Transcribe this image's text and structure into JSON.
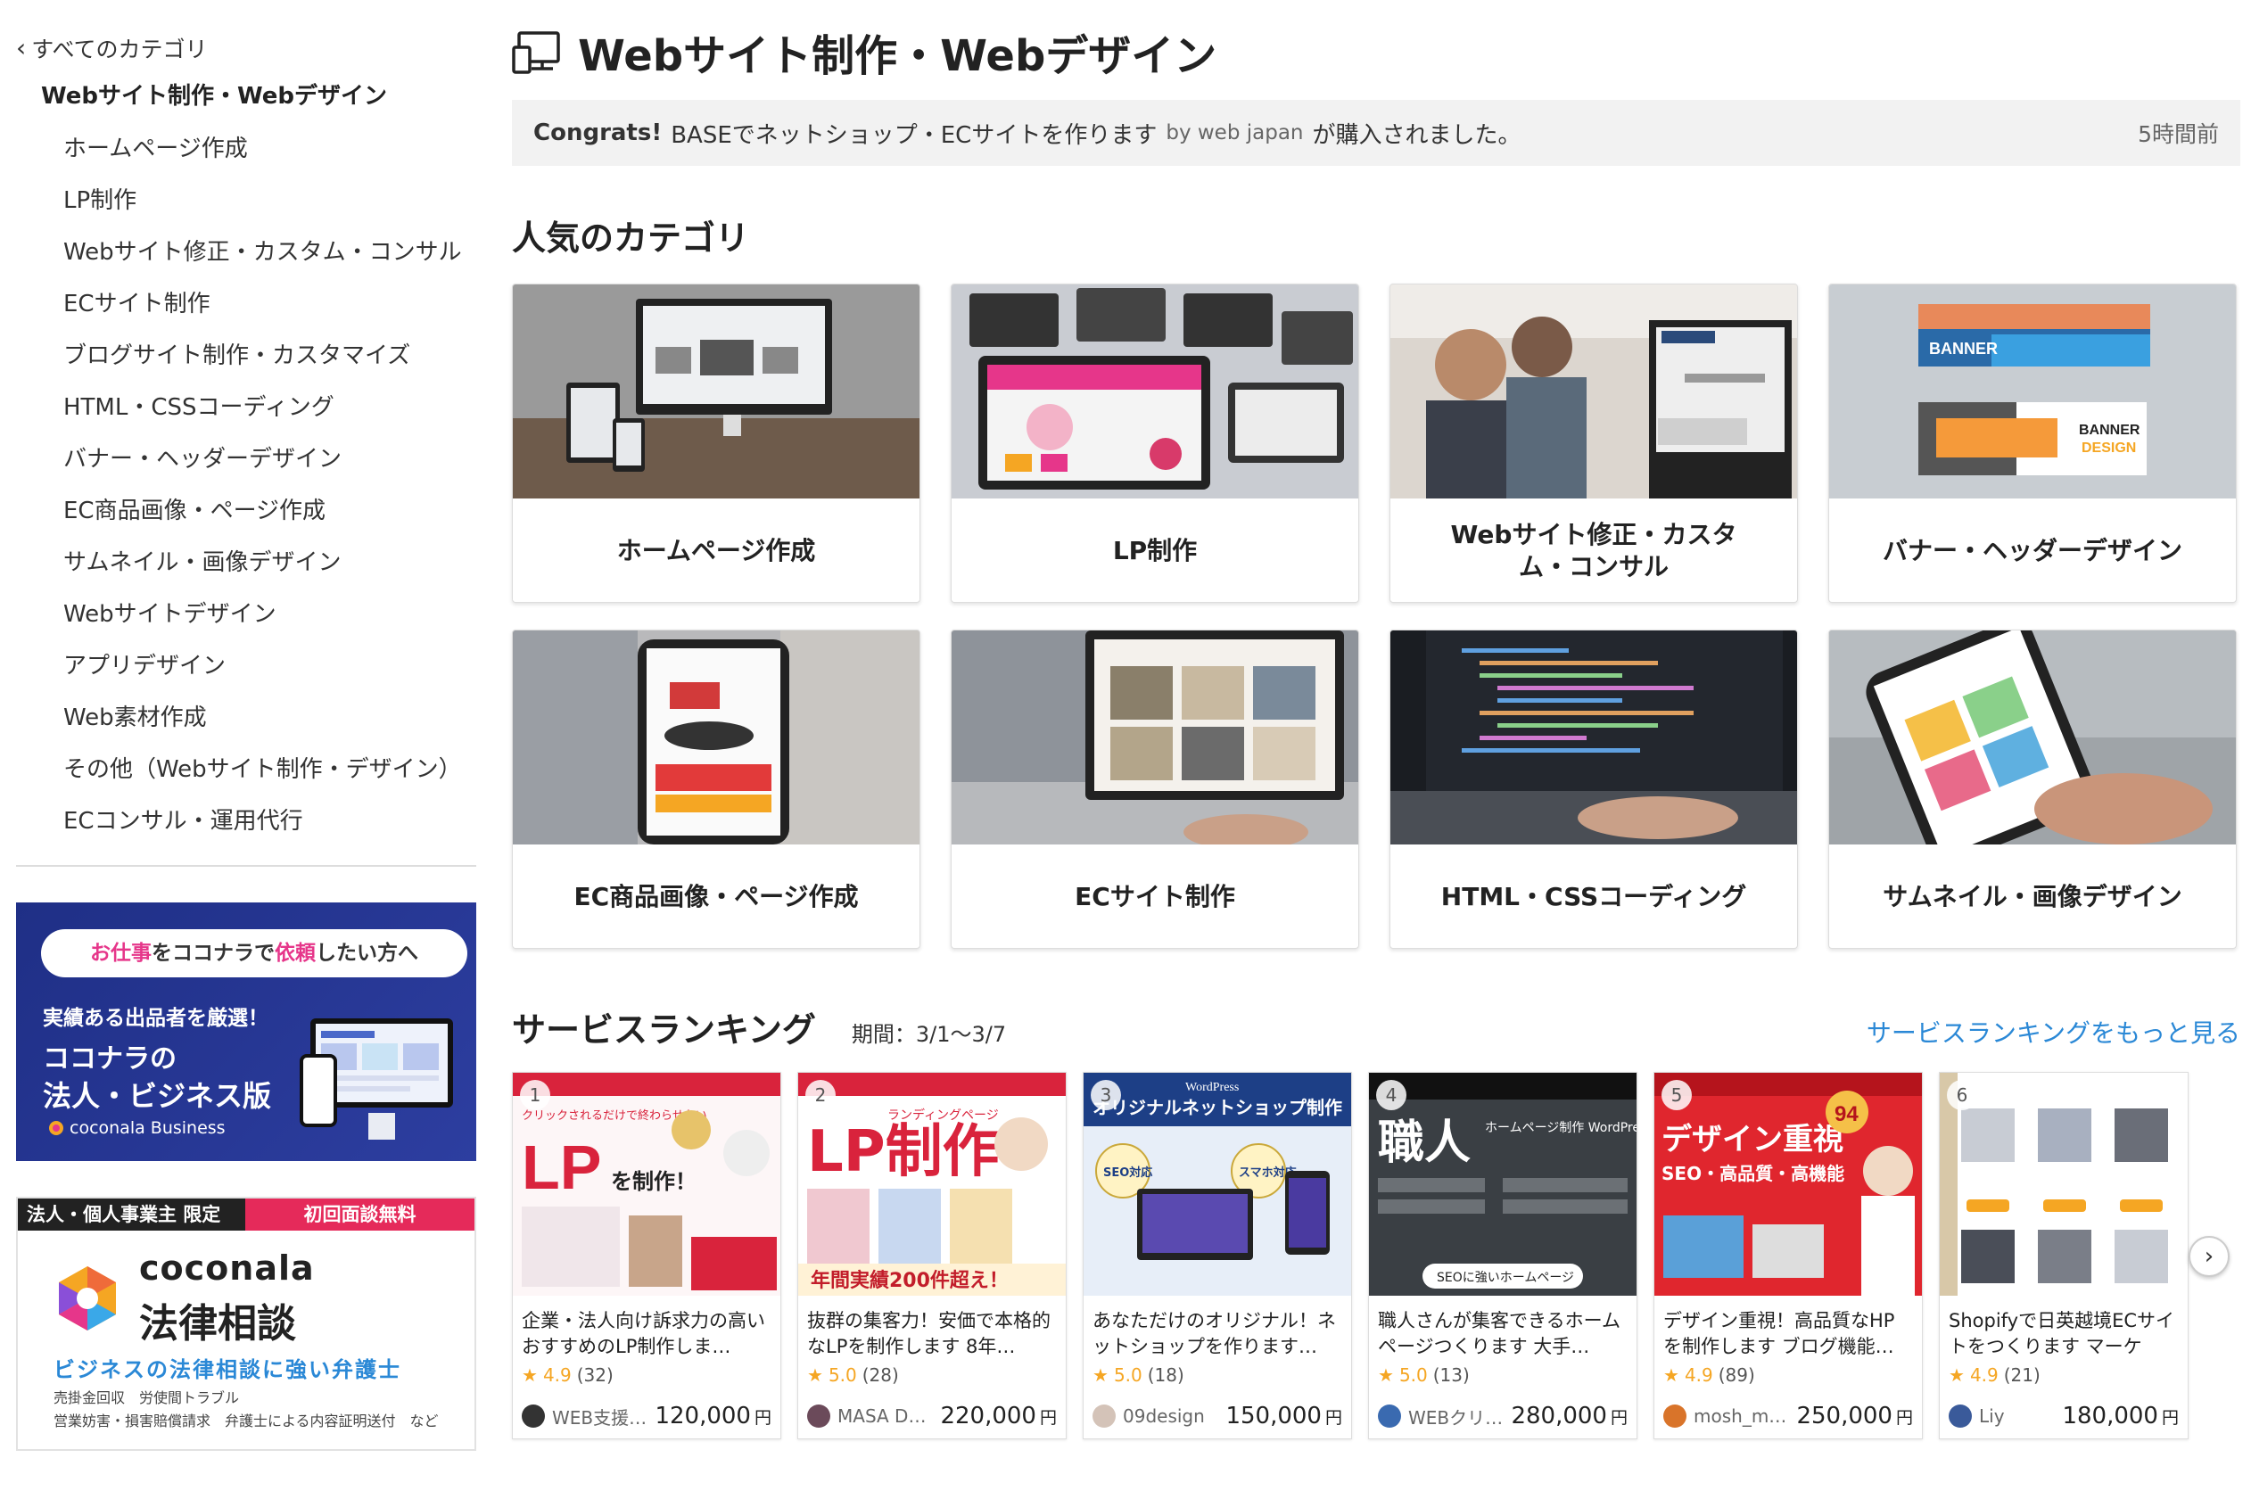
{
  "sidebar": {
    "back_label": "すべてのカテゴリ",
    "current": "Webサイト制作・Webデザイン",
    "items": [
      "ホームページ作成",
      "LP制作",
      "Webサイト修正・カスタム・コンサル",
      "ECサイト制作",
      "ブログサイト制作・カスタマイズ",
      "HTML・CSSコーディング",
      "バナー・ヘッダーデザイン",
      "EC商品画像・ページ作成",
      "サムネイル・画像デザイン",
      "Webサイトデザイン",
      "アプリデザイン",
      "Web素材作成",
      "その他（Webサイト制作・デザイン）",
      "ECコンサル・運用代行"
    ],
    "ad_business": {
      "pill_part1": "お仕事",
      "pill_part2": "をココナラで",
      "pill_part3": "依頼",
      "pill_part4": "したい方へ",
      "line1": "実績ある出品者を厳選！",
      "line2": "ココナラの",
      "line3": "法人・ビジネス版",
      "brand": "coconala Business"
    },
    "ad_legal": {
      "tag1": "法人・個人事業主 限定",
      "tag2": "初回面談無料",
      "brand1": "coconala",
      "brand2": "法律相談",
      "tagline": "ビジネスの法律相談に強い弁護士",
      "small1": "売掛金回収　労使間トラブル",
      "small2": "営業妨害・損害賠償請求　弁護士による内容証明送付　など"
    }
  },
  "main": {
    "title": "Webサイト制作・Webデザイン",
    "notice": {
      "congrats": "Congrats!",
      "text": "BASEでネットショップ・ECサイトを作ります",
      "by": "by web japan",
      "suffix": "が購入されました。",
      "time": "5時間前"
    },
    "popular_heading": "人気のカテゴリ",
    "categories": [
      "ホームページ作成",
      "LP制作",
      "Webサイト修正・カスタム・コンサル",
      "バナー・ヘッダーデザイン",
      "EC商品画像・ページ作成",
      "ECサイト制作",
      "HTML・CSSコーディング",
      "サムネイル・画像デザイン"
    ],
    "ranking": {
      "heading": "サービスランキング",
      "period": "期間：3/1〜3/7",
      "more": "サービスランキングをもっと見る",
      "services": [
        {
          "rank": "1",
          "title": "企業・法人向け訴求力の高いおすすめのLP制作しま…",
          "score": "4.9",
          "count": "(32)",
          "seller": "WEB支援…",
          "price": "120,000",
          "yen": "円"
        },
        {
          "rank": "2",
          "title": "抜群の集客力！安価で本格的なLPを制作します 8年…",
          "score": "5.0",
          "count": "(28)",
          "seller": "MASA D…",
          "price": "220,000",
          "yen": "円"
        },
        {
          "rank": "3",
          "title": "あなただけのオリジナル！ネットショップを作ります…",
          "score": "5.0",
          "count": "(18)",
          "seller": "09design",
          "price": "150,000",
          "yen": "円"
        },
        {
          "rank": "4",
          "title": "職人さんが集客できるホームページつくります 大手…",
          "score": "5.0",
          "count": "(13)",
          "seller": "WEBクリ…",
          "price": "280,000",
          "yen": "円"
        },
        {
          "rank": "5",
          "title": "デザイン重視！高品質なHPを制作します ブログ機能…",
          "score": "4.9",
          "count": "(89)",
          "seller": "mosh_m…",
          "price": "250,000",
          "yen": "円"
        },
        {
          "rank": "6",
          "title": "Shopifyで日英越境ECサイトをつくります マーケタ…",
          "score": "4.9",
          "count": "(21)",
          "seller": "Liy",
          "price": "180,000",
          "yen": "円"
        }
      ],
      "thumb_text": {
        "t1a": "LP",
        "t1b": "を制作！",
        "t1c": "クリックされるだけで終わらせない",
        "t2a": "LP制作",
        "t2b": "ランディングページ",
        "t2c": "年間実績200件超え！",
        "t3a": "オリジナルネットショップ制作",
        "t3b": "WordPress",
        "t3c": "SEO対応",
        "t3d": "スマホ対応",
        "t4a": "職人",
        "t4b": "ホームページ制作 WordPress",
        "t4c": "SEOに強いホームページ",
        "t5a": "デザイン重視",
        "t5b": "SEO・高品質・高機能",
        "t5c": "94"
      }
    }
  },
  "colors": {
    "accent_blue": "#2a88d6",
    "star": "#f5a623",
    "pink": "#e6368a",
    "navy": "#1f2f86"
  }
}
